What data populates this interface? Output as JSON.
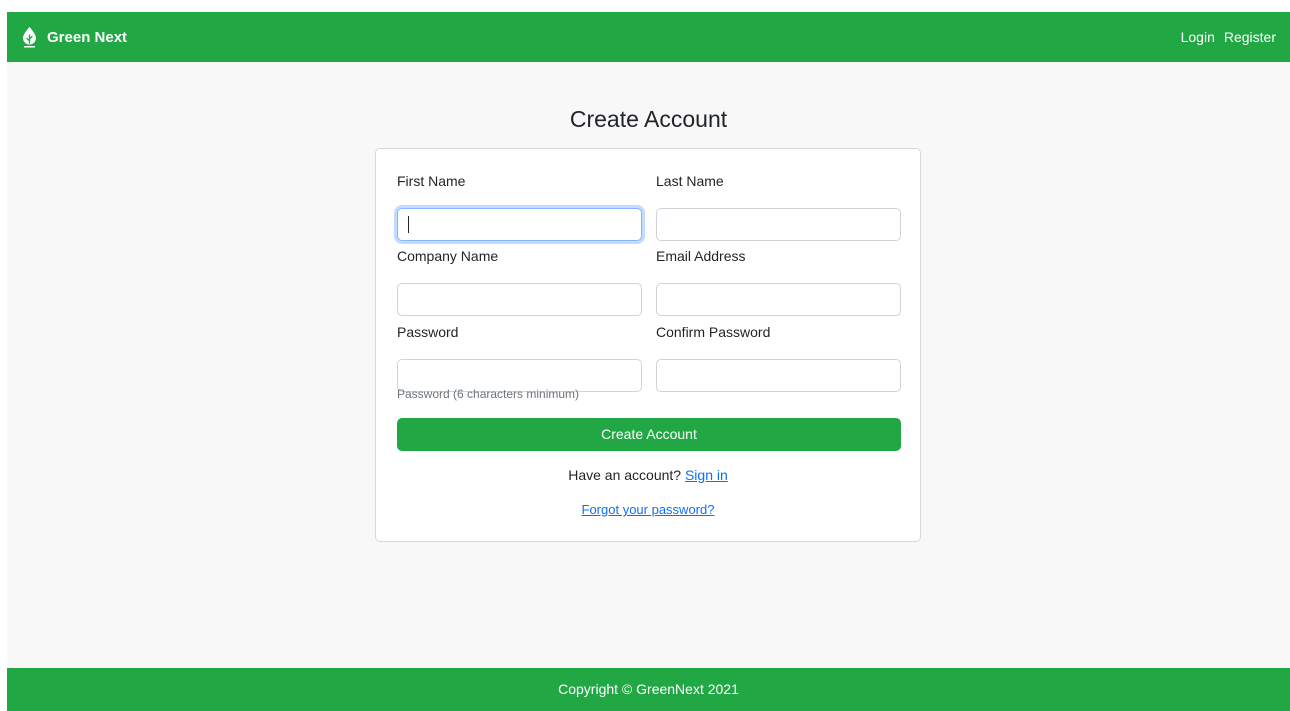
{
  "navbar": {
    "brand": "Green Next",
    "links": [
      "Login",
      "Register"
    ]
  },
  "page_title": "Create Account",
  "form": {
    "first_name_label": "First Name",
    "last_name_label": "Last Name",
    "company_name_label": "Company Name",
    "email_label": "Email Address",
    "password_label": "Password",
    "confirm_password_label": "Confirm Password",
    "first_name_value": "",
    "last_name_value": "",
    "company_name_value": "",
    "email_value": "",
    "password_value": "",
    "confirm_password_value": "",
    "password_help": "Password (6 characters minimum)",
    "submit_label": "Create Account",
    "have_account_text": "Have an account?",
    "sign_in_link": "Sign in",
    "forgot_link": "Forgot your password?"
  },
  "footer": {
    "copyright": "Copyright © GreenNext 2021"
  },
  "icons": {
    "brand_logo": "leaf-drop-icon"
  },
  "colors": {
    "brand_green": "#22a745",
    "link_blue": "#0d6efd",
    "focus_blue": "#86b7fe",
    "page_background": "#f8f8f8"
  }
}
